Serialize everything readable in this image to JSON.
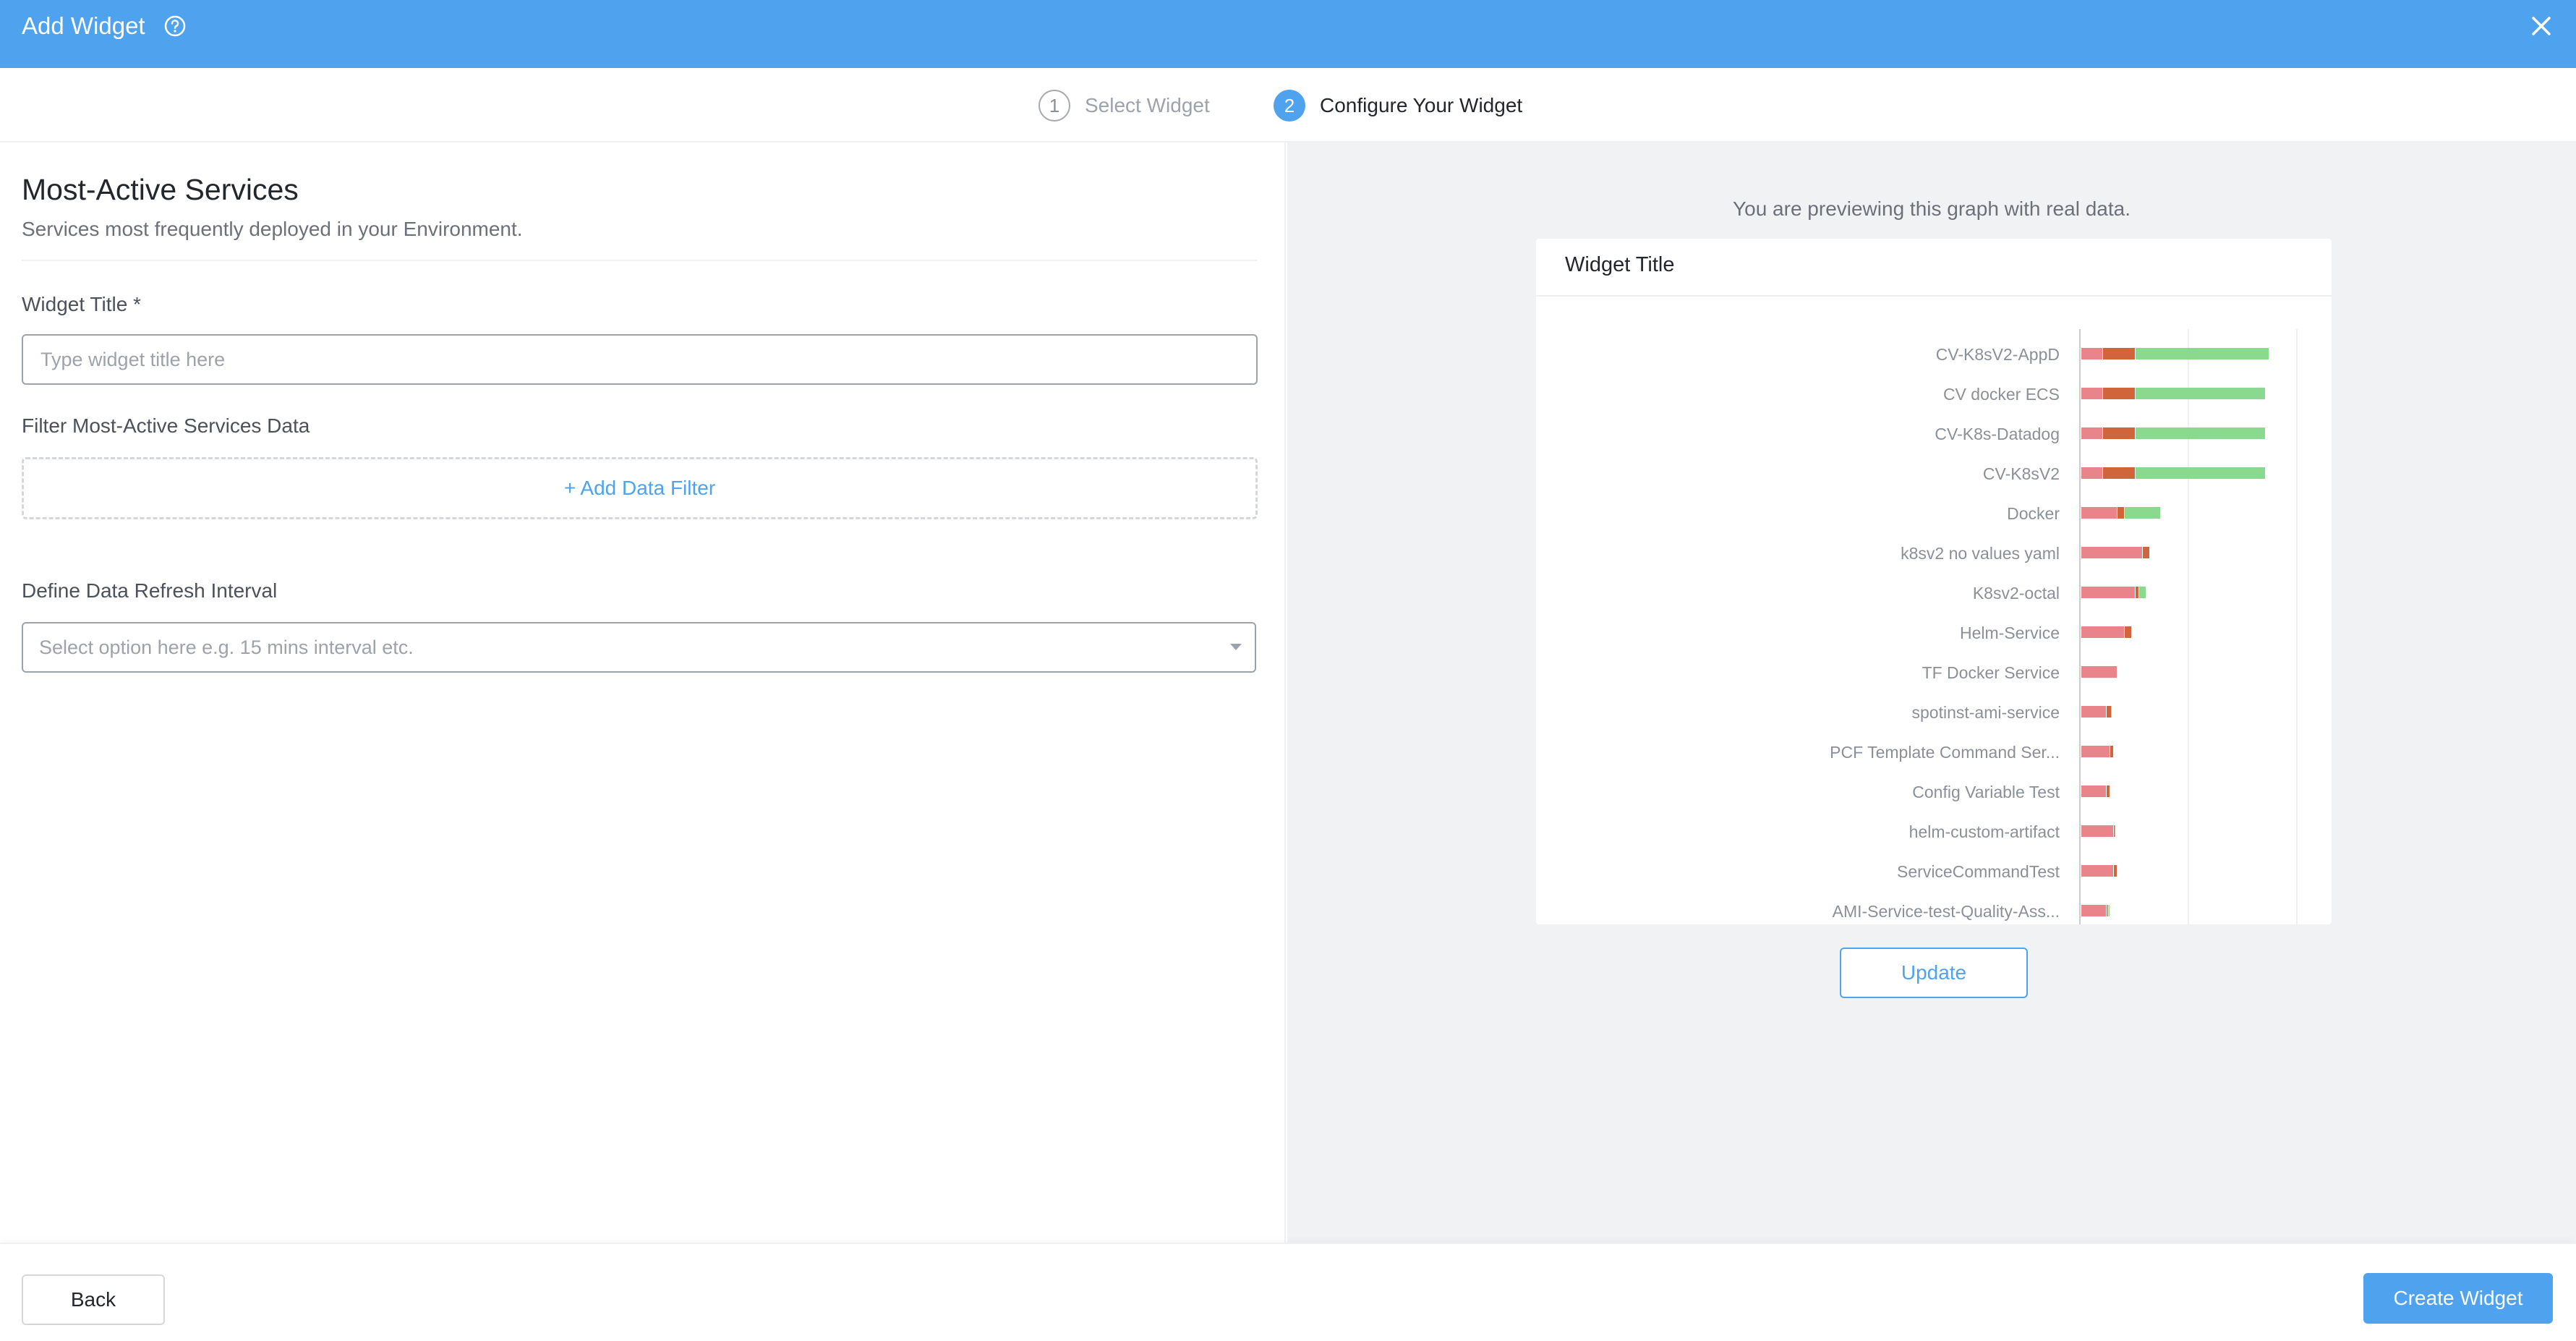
{
  "header": {
    "title": "Add Widget",
    "help_icon": "help-circle-icon",
    "close_icon": "close-icon"
  },
  "steps": [
    {
      "number": "1",
      "label": "Select Widget",
      "active": false
    },
    {
      "number": "2",
      "label": "Configure Your Widget",
      "active": true
    }
  ],
  "form": {
    "title": "Most-Active Services",
    "description": "Services most frequently deployed in your Environment.",
    "widget_title_label": "Widget Title *",
    "widget_title_placeholder": "Type widget title here",
    "filter_label": "Filter Most-Active Services Data",
    "add_filter_label": "+ Add Data Filter",
    "refresh_label": "Define Data Refresh Interval",
    "refresh_placeholder": "Select option here e.g. 15 mins interval etc."
  },
  "preview": {
    "note": "You are previewing this graph with real data.",
    "widget_title": "Widget Title",
    "update_label": "Update"
  },
  "footer": {
    "back_label": "Back",
    "create_label": "Create Widget"
  },
  "colors": {
    "accent": "#4fa3ee",
    "failed": "#e8848a",
    "aborted": "#d0643a",
    "success": "#8bd88f"
  },
  "chart_data": {
    "type": "bar",
    "orientation": "horizontal",
    "stacked": true,
    "categories": [
      "CV-K8sV2-AppD",
      "CV docker ECS",
      "CV-K8s-Datadog",
      "CV-K8sV2",
      "Docker",
      "k8sv2 no values yaml",
      "K8sv2-octal",
      "Helm-Service",
      "TF Docker Service",
      "spotinst-ami-service",
      "PCF Template Command Ser...",
      "Config Variable Test",
      "helm-custom-artifact",
      "ServiceCommandTest",
      "AMI-Service-test-Quality-Ass..."
    ],
    "series": [
      {
        "values": [
          6,
          6,
          6,
          6,
          10,
          17,
          15,
          12,
          10,
          7,
          8,
          7,
          9,
          9,
          7
        ]
      },
      {
        "values": [
          9,
          9,
          9,
          9,
          2,
          2,
          1,
          2,
          0,
          1.5,
          1,
          1,
          0.5,
          1,
          0.5
        ]
      },
      {
        "values": [
          37,
          36,
          36,
          36,
          10,
          0,
          2,
          0,
          0,
          0,
          0,
          0,
          0,
          0,
          0.5
        ]
      }
    ],
    "xlim": [
      0,
      60
    ],
    "grid": true,
    "legend": "none"
  }
}
